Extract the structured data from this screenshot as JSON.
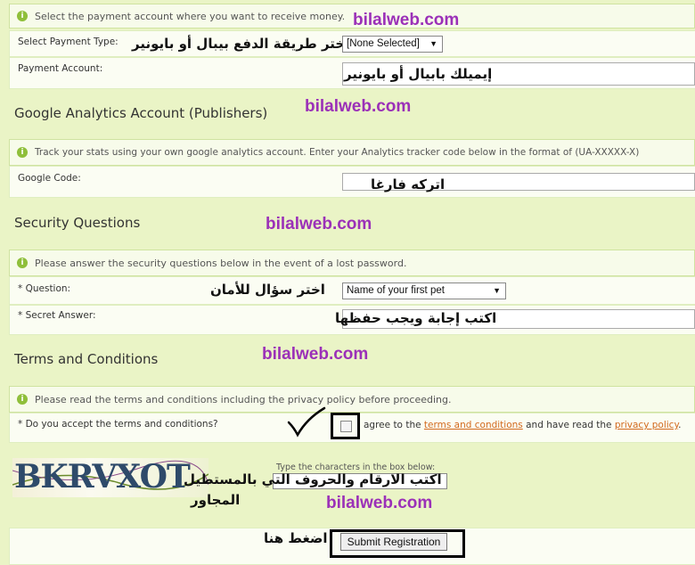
{
  "watermark": "bilalweb.com",
  "payment": {
    "info": "Select the payment account where you want to receive money.",
    "type_label": "Select Payment Type:",
    "type_value": "[None Selected]",
    "account_label": "Payment Account:",
    "note_type": "اختر طريقة الدفع بيبال أو بايونير",
    "note_account": "إيميلك بابيال أو بايونير"
  },
  "analytics": {
    "title": "Google Analytics Account (Publishers)",
    "info": "Track your stats using your own google analytics account. Enter your Analytics tracker code below in the format of (UA-XXXXX-X)",
    "code_label": "Google Code:",
    "note_code": "اتركه فارغا"
  },
  "security": {
    "title": "Security Questions",
    "info": "Please answer the security questions below in the event of a lost password.",
    "question_label": "* Question:",
    "question_value": "Name of your first pet",
    "answer_label": "* Secret Answer:",
    "note_question": "اختر سؤال للأمان",
    "note_answer": "اكتب إجابة ويجب حفظها"
  },
  "terms": {
    "title": "Terms and Conditions",
    "info": "Please read the terms and conditions including the privacy policy before proceeding.",
    "accept_label": "* Do you accept the terms and conditions?",
    "agree_prefix": "agree to the",
    "terms_link": "terms and conditions",
    "agree_middle": "and have read the",
    "privacy_link": "privacy policy",
    "agree_suffix": "."
  },
  "captcha": {
    "image_text": "BKRVXOT",
    "instruction": "Type the characters in the box below:",
    "note_line1": "اكتب الارقام والحروف التي بالمستطيل",
    "note_line2": "المجاور"
  },
  "submit": {
    "button_label": "Submit Registration",
    "note": "اضغط هنا"
  },
  "colors": {
    "background": "#eaf4c6",
    "watermark": "#9b30b8",
    "link": "#d2691e"
  },
  "icons": {
    "info": "info-circle-icon",
    "check": "checkmark-drawn-icon"
  }
}
